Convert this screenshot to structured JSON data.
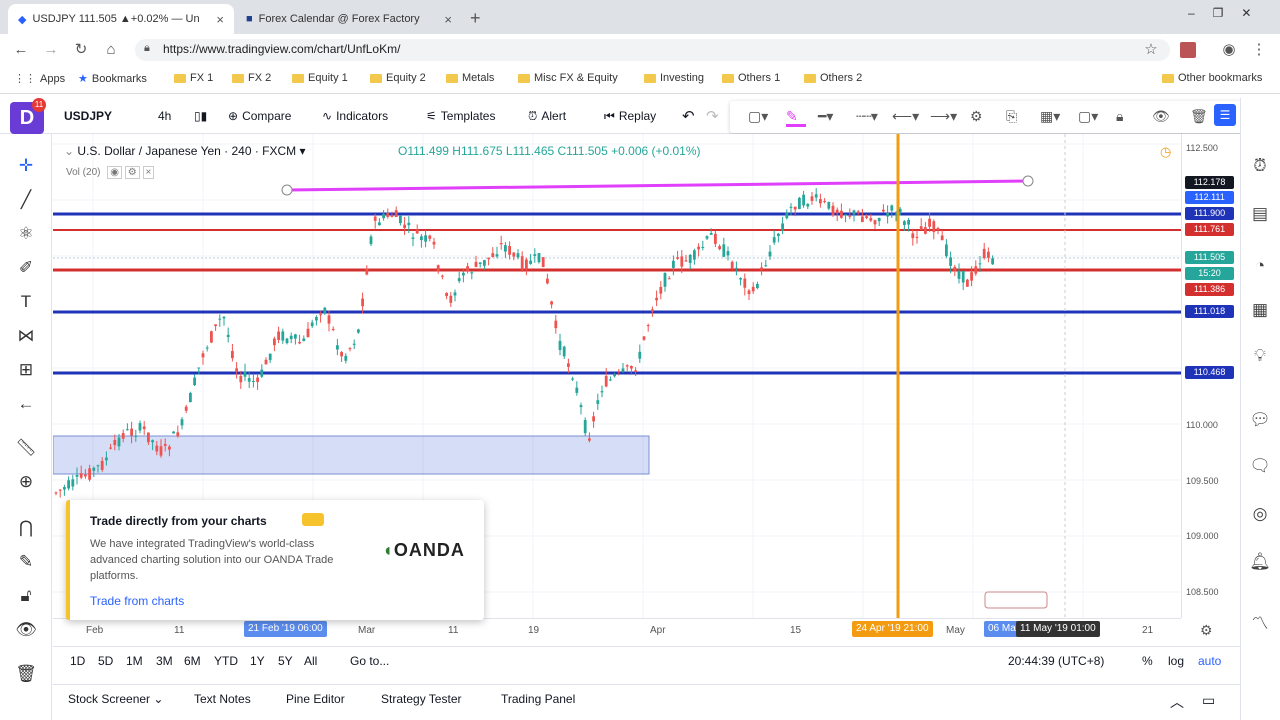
{
  "browser": {
    "tabs": [
      {
        "label": "USDJPY 111.505 ▲+0.02% — Un",
        "active": true
      },
      {
        "label": "Forex Calendar @ Forex Factory",
        "active": false
      }
    ],
    "new_tab": "+",
    "url": "https://www.tradingview.com/chart/UnfLoKm/",
    "bookmarks": [
      "Apps",
      "Bookmarks",
      "FX 1",
      "FX 2",
      "Equity 1",
      "Equity 2",
      "Metals",
      "Misc FX & Equity",
      "Investing",
      "Others 1",
      "Others 2",
      "Other bookmarks"
    ]
  },
  "toolbar": {
    "symbol": "USDJPY",
    "interval": "4h",
    "compare": "Compare",
    "indicators": "Indicators",
    "templates": "Templates",
    "alert": "Alert",
    "replay": "Replay"
  },
  "legend": {
    "title": "U.S. Dollar / Japanese Yen · 240 · FXCM",
    "open": "O111.499",
    "high": "H111.675",
    "low": "L111.465",
    "close": "C111.505",
    "change": "+0.006 (+0.01%)",
    "volume": "Vol (20)"
  },
  "price_axis": {
    "ticks": [
      "112.500",
      "110.000",
      "109.500",
      "109.000",
      "108.500"
    ],
    "tags": [
      {
        "value": "112.178",
        "color": "#131722"
      },
      {
        "value": "112.111",
        "color": "#2962ff"
      },
      {
        "value": "111.900",
        "color": "#1f33b8"
      },
      {
        "value": "111.761",
        "color": "#d32f2f"
      },
      {
        "value": "111.505",
        "color": "#26a69a"
      },
      {
        "value": "15:20",
        "color": "#26a69a"
      },
      {
        "value": "111.386",
        "color": "#d32f2f"
      },
      {
        "value": "111.018",
        "color": "#1f33b8"
      },
      {
        "value": "110.468",
        "color": "#1f33b8"
      }
    ]
  },
  "time_axis": {
    "labels": [
      "Feb",
      "11",
      "Mar",
      "11",
      "19",
      "Apr",
      "15",
      "May",
      "21"
    ],
    "tags": [
      {
        "text": "21 Feb '19  06:00",
        "color": "#5b8def"
      },
      {
        "text": "24 Apr '19  21:00",
        "color": "#f39c12"
      },
      {
        "text": "06 Ma",
        "color": "#5b8def"
      },
      {
        "text": "11 May '19  01:00",
        "color": "#333"
      }
    ]
  },
  "bottom_bar": {
    "ranges": [
      "1D",
      "5D",
      "1M",
      "3M",
      "6M",
      "YTD",
      "1Y",
      "5Y",
      "All"
    ],
    "goto": "Go to...",
    "clock": "20:44:39 (UTC+8)",
    "percent": "%",
    "log": "log",
    "auto": "auto"
  },
  "panels": [
    "Stock Screener",
    "Text Notes",
    "Pine Editor",
    "Strategy Tester",
    "Trading Panel"
  ],
  "popup": {
    "title": "Trade directly from your charts",
    "body": "We have integrated TradingView's world-class advanced charting solution into our OANDA Trade platforms.",
    "link": "Trade from charts",
    "brand": "OANDA"
  },
  "colors": {
    "accent": "#2962ff",
    "bull": "#26a69a",
    "bear": "#ef5350",
    "support": "#1f33b8",
    "resistance": "#d32f2f",
    "magenta": "#e040fb",
    "vline": "#f39c12"
  }
}
